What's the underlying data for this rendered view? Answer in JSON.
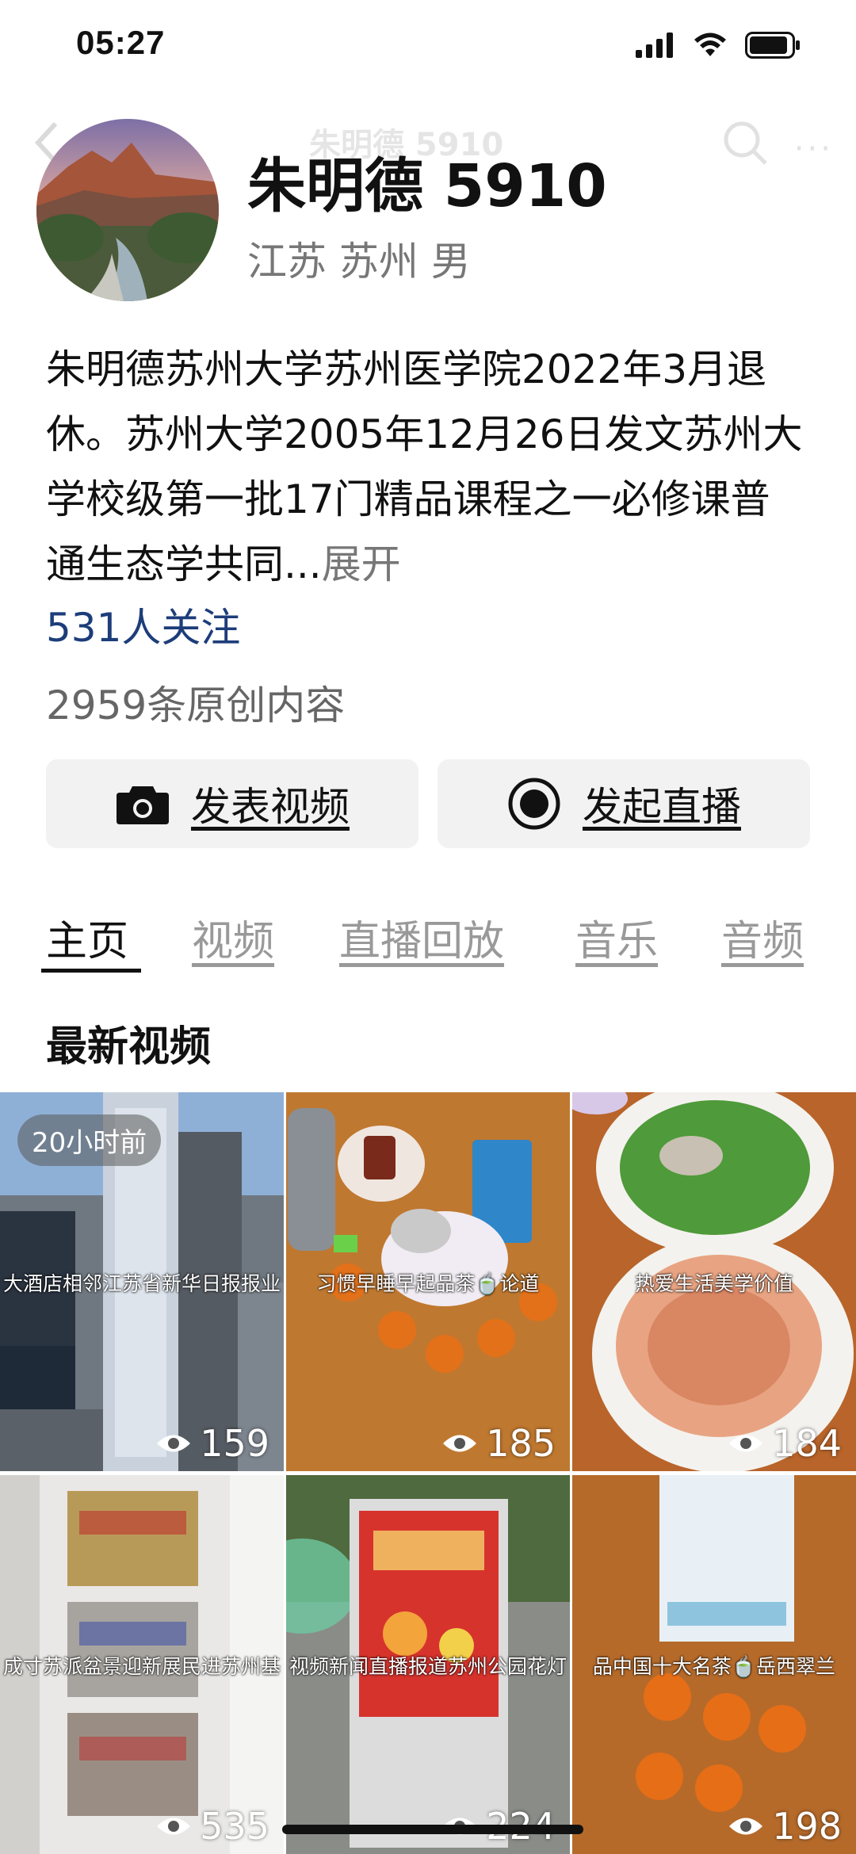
{
  "status_bar": {
    "time": "05:27"
  },
  "nav": {
    "ghost_title": "朱明德 5910"
  },
  "profile": {
    "name": "朱明德 5910",
    "location": "江苏 苏州 男",
    "bio": "朱明德苏州大学苏州医学院2022年3月退休。苏州大学2005年12月26日发文苏州大学校级第一批17门精品课程之一必修课普通生态学共同...",
    "bio_expand": "展开",
    "followers": "531人关注",
    "content_count": "2959条原创内容"
  },
  "actions": {
    "post_video": "发表视频",
    "start_live": "发起直播"
  },
  "tabs": [
    {
      "label": "主页",
      "active": true
    },
    {
      "label": "视频"
    },
    {
      "label": "直播回放"
    },
    {
      "label": "音乐"
    },
    {
      "label": "音频"
    }
  ],
  "section_title": "最新视频",
  "videos": [
    {
      "caption": "大酒店相邻江苏省新华日报报业",
      "views": "159",
      "badge": "20小时前"
    },
    {
      "caption": "习惯早睡早起品茶🍵论道",
      "views": "185"
    },
    {
      "caption": "热爱生活美学价值",
      "views": "184"
    },
    {
      "caption": "成寸苏派盆景迎新展民进苏州基",
      "views": "535"
    },
    {
      "caption": "视频新闻直播报道苏州公园花灯",
      "views": "224"
    },
    {
      "caption": "品中国十大名茶🍵岳西翠兰",
      "views": "198"
    }
  ],
  "icons": [
    "signal-icon",
    "wifi-icon",
    "battery-icon",
    "camera-icon",
    "live-record-icon",
    "eye-icon"
  ]
}
